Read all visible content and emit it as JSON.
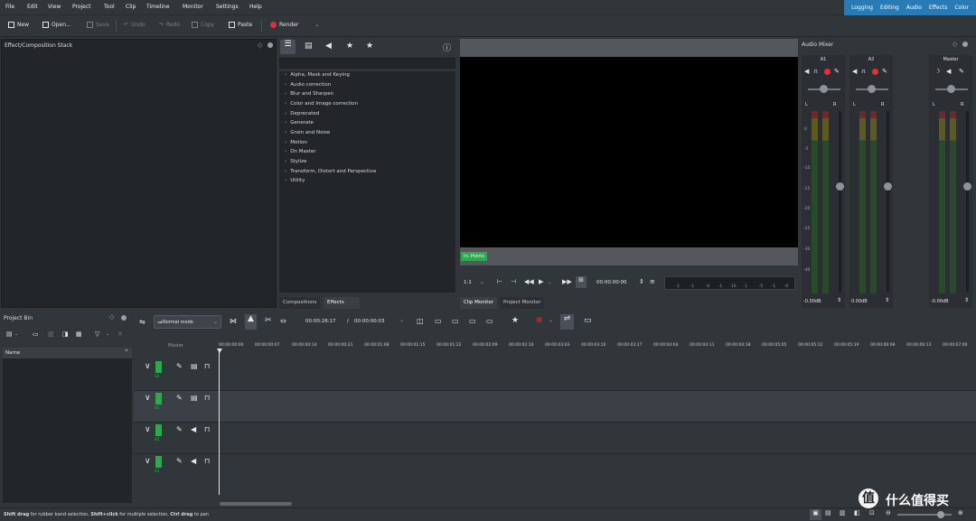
{
  "menu": [
    "File",
    "Edit",
    "View",
    "Project",
    "Tool",
    "Clip",
    "Timeline",
    "Monitor",
    "Settings",
    "Help"
  ],
  "workspaces": [
    "Logging",
    "Editing",
    "Audio",
    "Effects",
    "Color"
  ],
  "toolbar": {
    "new": "New",
    "open": "Open...",
    "save": "Save",
    "undo": "Undo",
    "redo": "Redo",
    "copy": "Copy",
    "paste": "Paste",
    "render": "Render"
  },
  "effect_stack": {
    "title": "Effect/Composition Stack"
  },
  "effects": {
    "items": [
      "Alpha, Mask and Keying",
      "Audio correction",
      "Blur and Sharpen",
      "Color and Image correction",
      "Deprecated",
      "Generate",
      "Grain and Noise",
      "Motion",
      "On Master",
      "Stylize",
      "Transform, Distort and Perspective",
      "Utility"
    ],
    "tabs": [
      "Compositions",
      "Effects"
    ]
  },
  "monitor": {
    "badge": "In: Points",
    "zoom": "1:1",
    "timecode": "00:00:00:00",
    "ruler_ticks": [
      "-1",
      "-1",
      "-0",
      "-1",
      "-10",
      "-1",
      "-5",
      "-1",
      "-0"
    ],
    "tabs": [
      "Clip Monitor",
      "Project Monitor"
    ]
  },
  "mixer": {
    "title": "Audio Mixer",
    "channels": [
      {
        "name": "A1",
        "level": "-0.00dB"
      },
      {
        "name": "A2",
        "level": "0.00dB"
      },
      {
        "name": "Master",
        "level": "-0.00dB"
      }
    ],
    "scale": [
      "0",
      "-5",
      "-10",
      "-15",
      "-20",
      "-25",
      "-30",
      "-40"
    ]
  },
  "project_bin": {
    "title": "Project Bin",
    "column": "Name"
  },
  "timeline": {
    "mode": "Normal mode",
    "position": "00:00:26:17",
    "duration": "00:00:00:03",
    "master_label": "Master",
    "timecodes": [
      "00:00:00:00",
      "00:00:00:07",
      "00:00:00:14",
      "00:00:00:21",
      "00:00:01:08",
      "00:00:01:15",
      "00:00:01:22",
      "00:00:02:09",
      "00:00:02:16",
      "00:00:03:03",
      "00:00:03:10",
      "00:00:03:17",
      "00:00:04:04",
      "00:00:04:11",
      "00:00:04:18",
      "00:00:05:05",
      "00:00:05:12",
      "00:00:05:19",
      "00:00:06:06",
      "00:00:06:13",
      "00:00:07:00"
    ],
    "tracks": [
      {
        "name": "V2",
        "type": "video"
      },
      {
        "name": "V1",
        "type": "video"
      },
      {
        "name": "A1",
        "type": "audio"
      },
      {
        "name": "A2",
        "type": "audio"
      }
    ]
  },
  "status": {
    "hint_bold1": "Shift drag",
    "hint_text1": " for rubber band selection, ",
    "hint_bold2": "Shift+click",
    "hint_text2": " for multiple selection, ",
    "hint_bold3": "Ctrl drag",
    "hint_text3": " to pan"
  },
  "watermark": "什么值得买",
  "colors": {
    "accent": "#2a7bb5",
    "green": "#2fa84f",
    "record": "#e0303a"
  }
}
